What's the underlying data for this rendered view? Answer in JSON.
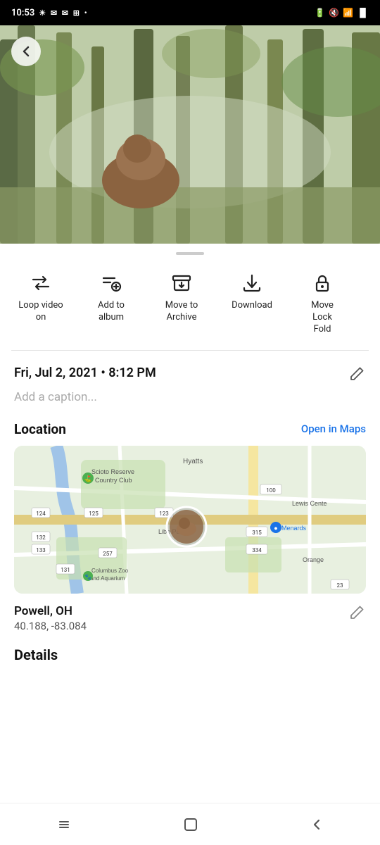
{
  "statusBar": {
    "time": "10:53",
    "icons": [
      "brightness",
      "message",
      "message2",
      "grid",
      "dot"
    ]
  },
  "photo": {
    "altText": "Brown bear in forest"
  },
  "backButton": {
    "label": "back"
  },
  "dragHandle": {},
  "actions": [
    {
      "id": "loop-video",
      "icon": "loop",
      "label": "Loop video\non"
    },
    {
      "id": "add-to-album",
      "icon": "add-to-album",
      "label": "Add to\nalbum"
    },
    {
      "id": "move-to-archive",
      "icon": "archive",
      "label": "Move to\nArchive"
    },
    {
      "id": "download",
      "icon": "download",
      "label": "Download"
    },
    {
      "id": "move-lock-fold",
      "icon": "lock",
      "label": "Move\nLock\nFold"
    }
  ],
  "info": {
    "dateTime": "Fri, Jul 2, 2021 • 8:12 PM",
    "captionPlaceholder": "Add a caption...",
    "location": {
      "sectionTitle": "Location",
      "openMapsLabel": "Open in Maps",
      "city": "Powell, OH",
      "coords": "40.188, -83.084"
    }
  },
  "details": {
    "sectionTitle": "Details"
  },
  "navBar": {
    "backIcon": "chevron-left",
    "homeIcon": "square",
    "menuIcon": "bars"
  }
}
